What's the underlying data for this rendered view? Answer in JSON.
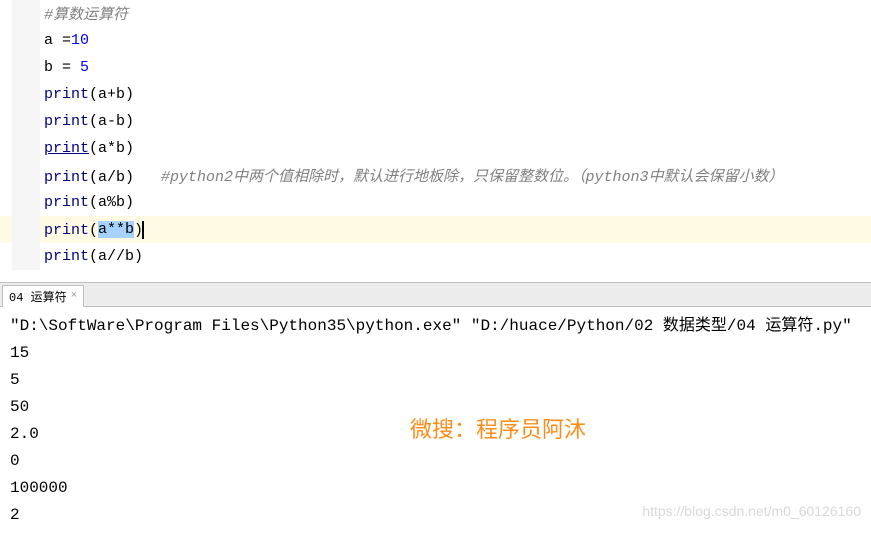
{
  "editor": {
    "lines": [
      {
        "tokens": [
          {
            "t": "#算数运算符",
            "c": "comment"
          }
        ]
      },
      {
        "tokens": [
          {
            "t": "a =",
            "c": ""
          },
          {
            "t": "10",
            "c": "num"
          }
        ]
      },
      {
        "tokens": [
          {
            "t": "b = ",
            "c": ""
          },
          {
            "t": "5",
            "c": "num"
          }
        ]
      },
      {
        "tokens": [
          {
            "t": "print",
            "c": "func"
          },
          {
            "t": "(a+b)",
            "c": ""
          }
        ]
      },
      {
        "tokens": [
          {
            "t": "print",
            "c": "func"
          },
          {
            "t": "(a-b)",
            "c": ""
          }
        ]
      },
      {
        "tokens": [
          {
            "t": "print",
            "c": "func-u"
          },
          {
            "t": "(a*b)",
            "c": ""
          }
        ]
      },
      {
        "tokens": [
          {
            "t": "print",
            "c": "func"
          },
          {
            "t": "(a/b)   ",
            "c": ""
          },
          {
            "t": "#python2中两个值相除时，默认进行地板除，只保留整数位。（python3中默认会保留小数）",
            "c": "comment"
          }
        ]
      },
      {
        "tokens": [
          {
            "t": "print",
            "c": "func"
          },
          {
            "t": "(a%b)",
            "c": ""
          }
        ]
      },
      {
        "tokens": [
          {
            "t": "print",
            "c": "func"
          },
          {
            "t": "(",
            "c": ""
          },
          {
            "t": "a**b",
            "c": "",
            "sel": true
          },
          {
            "t": ")",
            "c": ""
          }
        ],
        "hl": true,
        "cursor": true
      },
      {
        "tokens": [
          {
            "t": "print",
            "c": "func"
          },
          {
            "t": "(a//b)",
            "c": ""
          }
        ]
      }
    ]
  },
  "tab": {
    "label": "04 运算符",
    "close": "×"
  },
  "console": {
    "lines": [
      "\"D:\\SoftWare\\Program Files\\Python35\\python.exe\" \"D:/huace/Python/02 数据类型/04 运算符.py\"",
      "15",
      "5",
      "50",
      "2.0",
      "0",
      "100000",
      "2"
    ]
  },
  "watermark1": "微搜：程序员阿沐",
  "watermark2": "https://blog.csdn.net/m0_60126160"
}
